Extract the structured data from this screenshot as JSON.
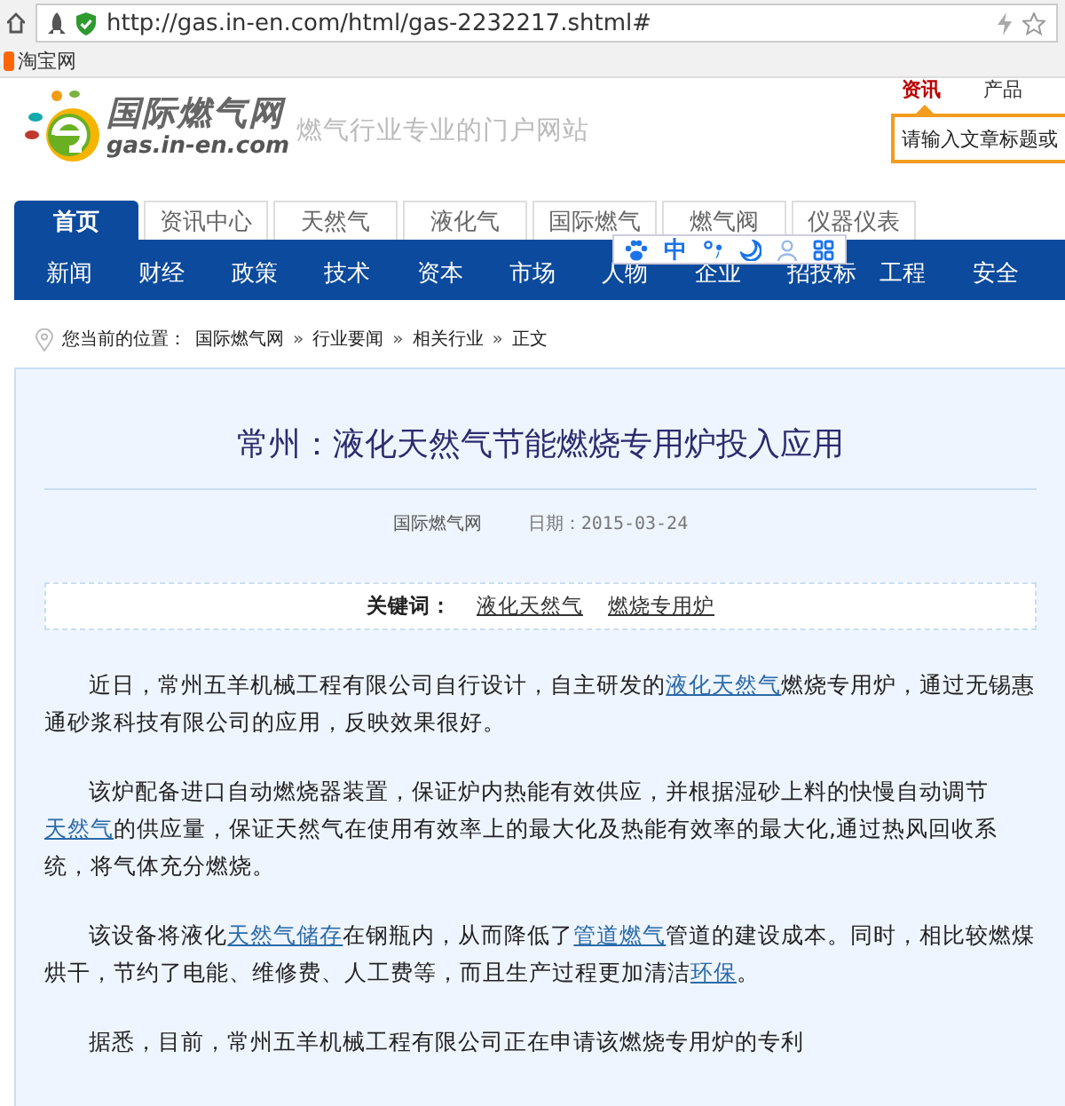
{
  "browser": {
    "url": "http://gas.in-en.com/html/gas-2232217.shtml#",
    "bookmarks": [
      {
        "label": "淘宝网"
      }
    ]
  },
  "header": {
    "logo_name": "国际燃气网",
    "logo_domain": "gas.in-en.com",
    "tagline": "燃气行业专业的门户网站",
    "top_links": [
      {
        "label": "资讯",
        "selected": true
      },
      {
        "label": "产品",
        "selected": false
      }
    ],
    "search": {
      "placeholder": "请输入文章标题或"
    }
  },
  "tabs": [
    {
      "label": "首页",
      "selected": true
    },
    {
      "label": "资讯中心",
      "selected": false
    },
    {
      "label": "天然气",
      "selected": false
    },
    {
      "label": "液化气",
      "selected": false
    },
    {
      "label": "国际燃气",
      "selected": false
    },
    {
      "label": "燃气阀",
      "selected": false
    },
    {
      "label": "仪器仪表",
      "selected": false
    }
  ],
  "nav": [
    "新闻",
    "财经",
    "政策",
    "技术",
    "资本",
    "市场",
    "人物",
    "企业",
    "招投标",
    "工程",
    "安全"
  ],
  "ime_toolbar": {
    "mode": "中"
  },
  "breadcrumb": {
    "label": "您当前的位置：",
    "separator": "»",
    "items": [
      "国际燃气网",
      "行业要闻",
      "相关行业",
      "正文"
    ]
  },
  "article": {
    "title": "常州：液化天然气节能燃烧专用炉投入应用",
    "source": "国际燃气网",
    "date": "日期：2015-03-24",
    "keywords_label": "关键词：",
    "keywords": [
      "液化天然气",
      "燃烧专用炉"
    ],
    "paragraphs": [
      [
        {
          "text": "近日，常州五羊机械工程有限公司自行设计，自主研发的",
          "link": false
        },
        {
          "text": "液化天然气",
          "link": true
        },
        {
          "text": "燃烧专用炉，通过无锡惠通砂浆科技有限公司的应用，反映效果很好。",
          "link": false
        }
      ],
      [
        {
          "text": "该炉配备进口自动燃烧器装置，保证炉内热能有效供应，并根据湿砂上料的快慢自动调节",
          "link": false
        },
        {
          "text": "天然气",
          "link": true
        },
        {
          "text": "的供应量，保证天然气在使用有效率上的最大化及热能有效率的最大化,通过热风回收系统，将气体充分燃烧。",
          "link": false
        }
      ],
      [
        {
          "text": "该设备将液化",
          "link": false
        },
        {
          "text": "天然气储存",
          "link": true
        },
        {
          "text": "在钢瓶内，从而降低了",
          "link": false
        },
        {
          "text": "管道燃气",
          "link": true
        },
        {
          "text": "管道的建设成本。同时，相比较燃煤烘干，节约了电能、维修费、人工费等，而且生产过程更加清洁",
          "link": false
        },
        {
          "text": "环保",
          "link": true
        },
        {
          "text": "。",
          "link": false
        }
      ],
      [
        {
          "text": "据悉，目前，常州五羊机械工程有限公司正在申请该燃烧专用炉的专利",
          "link": false
        }
      ]
    ]
  }
}
